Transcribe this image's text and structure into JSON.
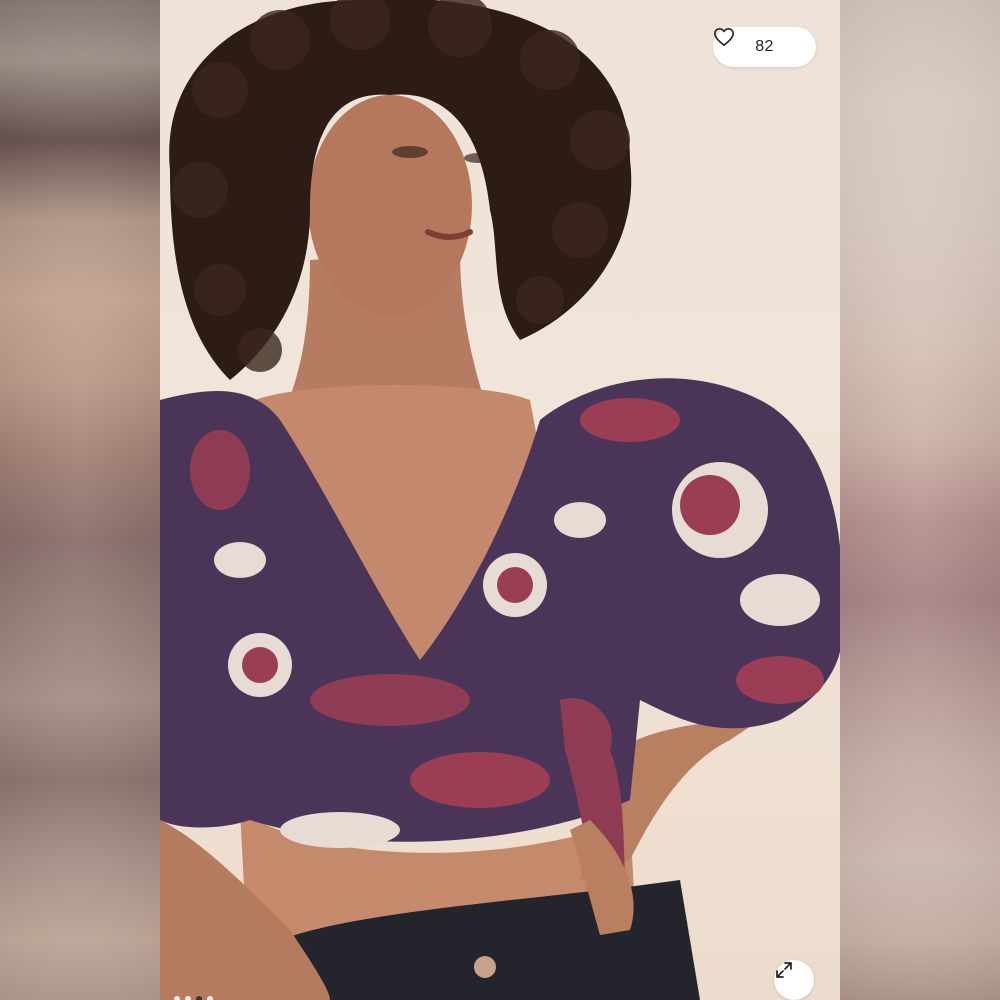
{
  "listing": {
    "like_count": "82",
    "like_icon": "heart-outline-icon",
    "expand_icon": "expand-arrows-icon"
  },
  "carousel": {
    "total_dots": 4,
    "active_index": 2
  },
  "colors": {
    "background": "#f0e3d8",
    "garment_base": "#4a3559",
    "garment_accent": "#9b3e55",
    "print_light": "#e7dcd3"
  }
}
